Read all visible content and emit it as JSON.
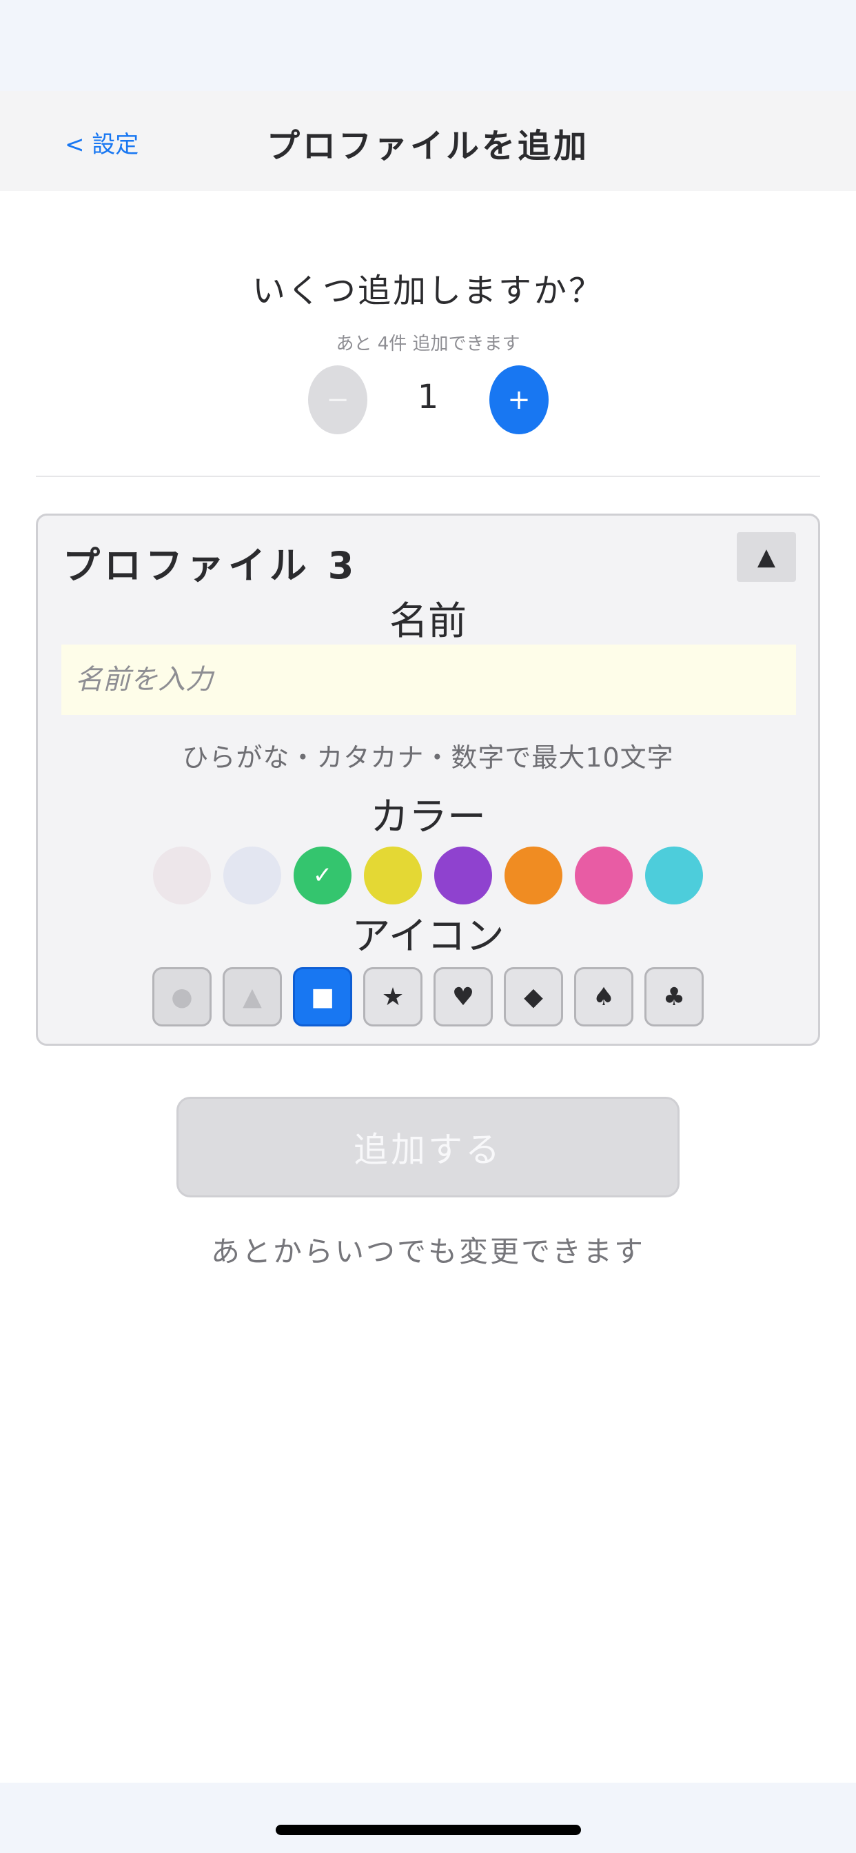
{
  "nav": {
    "back_label": "< 設定",
    "title": "プロファイルを追加"
  },
  "count": {
    "question": "いくつ追加しますか？",
    "remaining": "あと 4件 追加できます",
    "minus": "−",
    "value": "1",
    "plus": "+"
  },
  "profile": {
    "title": "プロファイル 3",
    "collapse_glyph": "▲",
    "name_label": "名前",
    "name_placeholder": "名前を入力",
    "name_value": "",
    "name_hint": "ひらがな・カタカナ・数字で最大10文字",
    "color_label": "カラー",
    "colors": [
      {
        "name": "pale-pink",
        "hex": "#ede6ea",
        "selected": false,
        "mark": ""
      },
      {
        "name": "pale-blue",
        "hex": "#e3e6f1",
        "selected": false,
        "mark": ""
      },
      {
        "name": "green",
        "hex": "#34c56e",
        "selected": true,
        "mark": "✓"
      },
      {
        "name": "yellow",
        "hex": "#e4d834",
        "selected": false,
        "mark": ""
      },
      {
        "name": "purple",
        "hex": "#8f42cf",
        "selected": false,
        "mark": ""
      },
      {
        "name": "orange",
        "hex": "#f08c22",
        "selected": false,
        "mark": ""
      },
      {
        "name": "pink",
        "hex": "#e85ca4",
        "selected": false,
        "mark": ""
      },
      {
        "name": "cyan",
        "hex": "#4dcddb",
        "selected": false,
        "mark": ""
      }
    ],
    "icon_label": "アイコン",
    "icons": [
      {
        "name": "circle-icon",
        "glyph": "●",
        "state": "faded"
      },
      {
        "name": "triangle-icon",
        "glyph": "▲",
        "state": "faded"
      },
      {
        "name": "square-icon",
        "glyph": "■",
        "state": "selected"
      },
      {
        "name": "star-icon",
        "glyph": "★",
        "state": "normal"
      },
      {
        "name": "heart-icon",
        "glyph": "♥",
        "state": "normal"
      },
      {
        "name": "diamond-icon",
        "glyph": "◆",
        "state": "normal"
      },
      {
        "name": "spade-icon",
        "glyph": "♠",
        "state": "normal"
      },
      {
        "name": "club-icon",
        "glyph": "♣",
        "state": "normal"
      }
    ]
  },
  "actions": {
    "add_label": "追加する",
    "footer_note": "あとからいつでも変更できます"
  }
}
